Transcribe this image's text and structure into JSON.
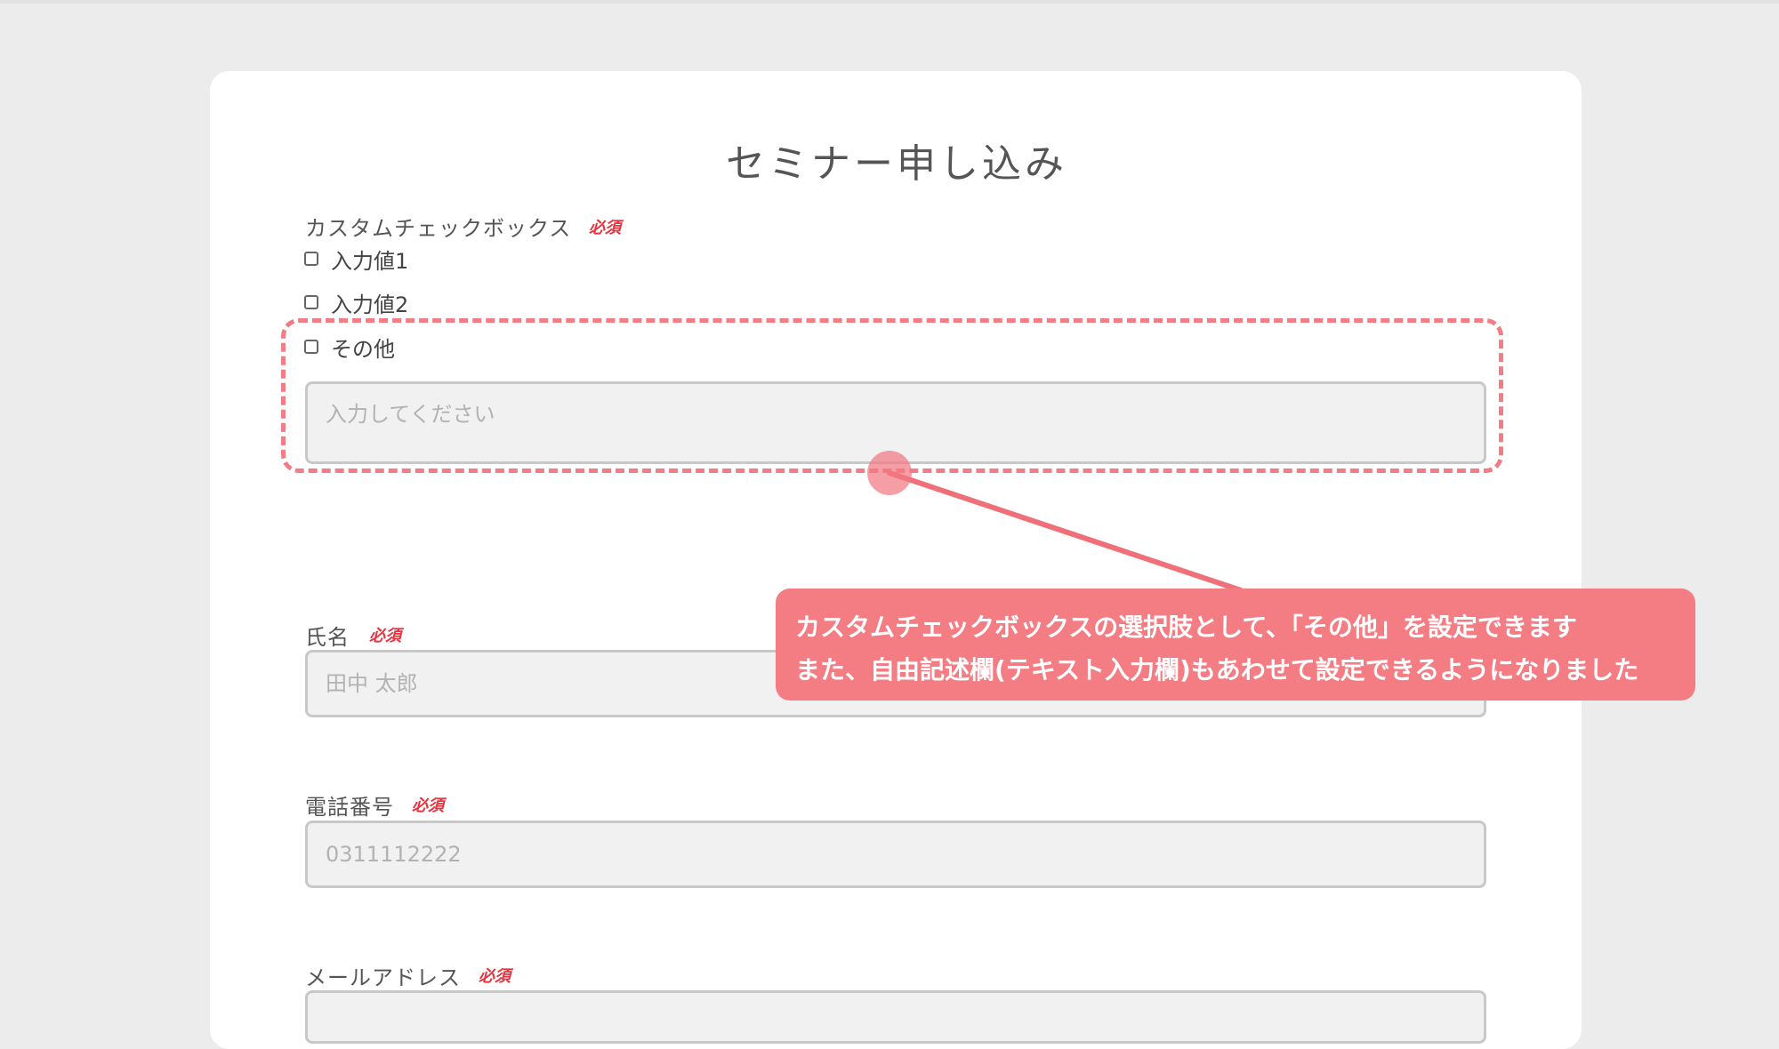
{
  "form": {
    "title": "セミナー申し込み",
    "checkbox_group": {
      "label": "カスタムチェックボックス",
      "required": "必須",
      "options": [
        "入力値1",
        "入力値2",
        "その他"
      ],
      "other_placeholder": "入力してください"
    },
    "name_field": {
      "label": "氏名",
      "required": "必須",
      "placeholder": "田中 太郎"
    },
    "phone_field": {
      "label": "電話番号",
      "required": "必須",
      "placeholder": "0311112222"
    },
    "email_field": {
      "label": "メールアドレス",
      "required": "必須"
    }
  },
  "callout": {
    "line1": "カスタムチェックボックスの選択肢として、「その他」を設定できます",
    "line2": "また、自由記述欄(テキスト入力欄)もあわせて設定できるようになりました"
  },
  "colors": {
    "background": "#ececec",
    "card": "#ffffff",
    "accent": "#f47d84",
    "required": "#e8333f",
    "input_bg": "#f1f1f1"
  }
}
